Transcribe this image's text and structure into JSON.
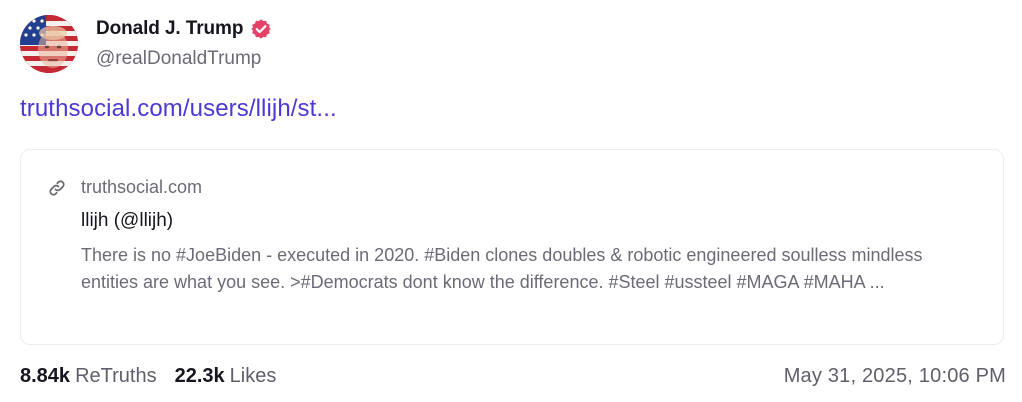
{
  "author": {
    "display_name": "Donald J. Trump",
    "handle": "@realDonaldTrump",
    "avatar_icon": "flag-portrait-avatar",
    "verified_icon": "verified-badge-icon",
    "verified_color": "#e5426a"
  },
  "post": {
    "link_text": "truthsocial.com/users/llijh/st...",
    "link_color": "#4b39d6"
  },
  "link_card": {
    "icon": "link-icon",
    "domain": "truthsocial.com",
    "title": "llijh (@llijh)",
    "description": "There is no #JoeBiden - executed in 2020. #Biden clones doubles & robotic engineered soulless mindless entities are what you see. >#Democrats dont know the difference. #Steel #ussteel #MAGA #MAHA ..."
  },
  "stats": {
    "retruths_count": "8.84k",
    "retruths_label": "ReTruths",
    "likes_count": "22.3k",
    "likes_label": "Likes"
  },
  "timestamp": "May 31, 2025, 10:06 PM"
}
